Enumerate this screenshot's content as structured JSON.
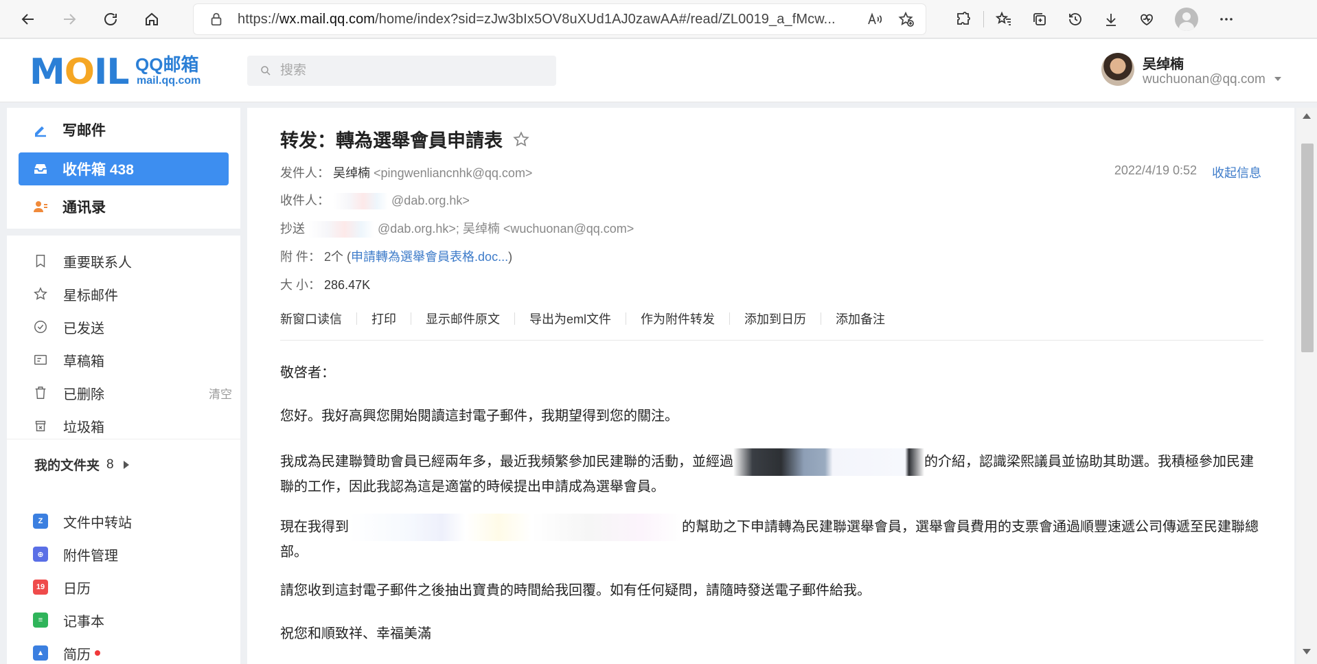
{
  "browser": {
    "url_prefix": "https://",
    "url_host": "wx.mail.qq.com",
    "url_path": "/home/index?sid=zJw3bIx5OV8uXUd1AJ0zawAA#/read/ZL0019_a_fMcw..."
  },
  "header": {
    "logo_text": "MOIL",
    "logo_brand": "QQ邮箱",
    "logo_domain": "mail.qq.com",
    "search_placeholder": "搜索",
    "user_name": "吴绰楠",
    "user_email": "wuchuonan@qq.com"
  },
  "sidebar": {
    "primary": [
      {
        "label": "写邮件"
      },
      {
        "label": "收件箱 438"
      },
      {
        "label": "通讯录"
      }
    ],
    "folders": [
      {
        "label": "重要联系人"
      },
      {
        "label": "星标邮件"
      },
      {
        "label": "已发送"
      },
      {
        "label": "草稿箱"
      },
      {
        "label": "已删除",
        "action": "清空"
      },
      {
        "label": "垃圾箱"
      }
    ],
    "my_folders_label": "我的文件夹",
    "my_folders_count": "8",
    "apps": [
      {
        "label": "文件中转站",
        "badge": "Z"
      },
      {
        "label": "附件管理",
        "badge": "⊕"
      },
      {
        "label": "日历",
        "badge": "19"
      },
      {
        "label": "记事本",
        "badge": "≡"
      },
      {
        "label": "简历",
        "badge": "▲"
      }
    ]
  },
  "mail": {
    "subject": "转发：轉為選舉會員申請表",
    "from_label": "发件人：",
    "from_name": "吴绰楠",
    "from_addr": "<pingwenliancnhk@qq.com>",
    "date": "2022/4/19 0:52",
    "collapse": "收起信息",
    "to_label": "收件人：",
    "to_addr": "@dab.org.hk>",
    "cc_label": "抄送",
    "cc_addr": "@dab.org.hk>; 吴绰楠 <wuchuonan@qq.com>",
    "attach_label": "附 件：",
    "attach_count": "2个 (",
    "attach_link": "申請轉為選舉會員表格.doc...",
    "attach_close": ")",
    "size_label": "大 小：",
    "size_value": "286.47K",
    "actions": [
      "新窗口读信",
      "打印",
      "显示邮件原文",
      "导出为eml文件",
      "作为附件转发",
      "添加到日历",
      "添加备注"
    ],
    "body": {
      "greeting": "敬啓者：",
      "p1": "您好。我好高興您開始閱讀這封電子郵件，我期望得到您的關注。",
      "p2_a": "我成為民建聯贊助會員已經兩年多，最近我頻繁參加民建聯的活動，並經過",
      "p2_b": "的介紹，認識梁熙議員並協助其助選。我積極參加民建聯的工作，因此我認為這是適當的時候提出申請成為選舉會員。",
      "p3_a": "現在我得到",
      "p3_b": "的幫助之下申請轉為民建聯選舉會員，選舉會員費用的支票會通過順豐速遞公司傳遞至民建聯總部。",
      "p4": "請您收到這封電子郵件之後抽出寶貴的時間給我回覆。如有任何疑問，請隨時發送電子郵件給我。",
      "p5": "祝您和順致祥、幸福美滿"
    }
  },
  "colors": {
    "accent": "#3d8ef0",
    "link": "#3d7bc9",
    "unread_dot": "#f0383a"
  }
}
